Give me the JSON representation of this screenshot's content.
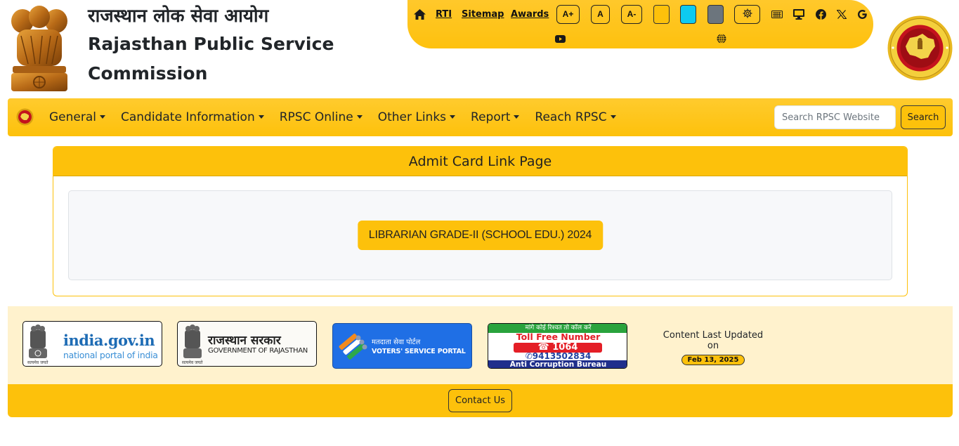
{
  "header": {
    "title_hindi": "राजस्थान लोक सेवा आयोग",
    "title_english_line1": "Rajasthan Public Service",
    "title_english_line2": "Commission",
    "emblem_icon": "ashoka-emblem",
    "seal_icon": "rpsc-seal"
  },
  "utility_bar": {
    "home_icon": "home-icon",
    "links": [
      "RTI",
      "Sitemap",
      "Awards"
    ],
    "font_size_buttons": [
      "A+",
      "A",
      "A-"
    ],
    "theme_swatches": [
      {
        "name": "yellow",
        "color": "#fdc10b"
      },
      {
        "name": "cyan",
        "color": "#0dcaf0"
      },
      {
        "name": "gray",
        "color": "#6c757d"
      }
    ],
    "settings_icon": "gear-icon",
    "icons": [
      "keyboard-icon",
      "monitor-icon",
      "facebook-icon",
      "x-twitter-icon",
      "google-icon",
      "youtube-icon",
      "globe-icon"
    ]
  },
  "navbar": {
    "logo_icon": "rpsc-seal-small",
    "items": [
      {
        "label": "General"
      },
      {
        "label": "Candidate Information"
      },
      {
        "label": "RPSC Online"
      },
      {
        "label": "Other Links"
      },
      {
        "label": "Report"
      },
      {
        "label": "Reach RPSC"
      }
    ],
    "search_placeholder": "Search RPSC Website",
    "search_value": "",
    "search_button": "Search"
  },
  "main": {
    "card_title": "Admit Card Link Page",
    "admit_card_link": "LIBRARIAN GRADE-II (SCHOOL EDU.) 2024"
  },
  "footer": {
    "logos": [
      {
        "title": "india.gov.in",
        "subtitle": "national portal of india",
        "motto": "सत्यमेव जयते"
      },
      {
        "title": "राजस्थान सरकार",
        "subtitle": "GOVERNMENT OF RAJASTHAN",
        "motto": "सत्यमेव जयते"
      },
      {
        "title": "मतदाता सेवा पोर्टल",
        "subtitle": "VOTERS' SERVICE PORTAL"
      },
      {
        "top": "मांगे कोई रिश्वत तो कॉल करें",
        "line1": "Toll Free Number",
        "number": "1064",
        "whatsapp": "9413502834",
        "bottom": "Anti Corruption Bureau"
      }
    ],
    "updated_label": "Content Last Updated on",
    "updated_date": "Feb 13, 2025",
    "contact_button": "Contact Us"
  },
  "colors": {
    "brand_yellow": "#fdc10b",
    "logo_band_bg": "#fff2cd",
    "text_dark": "#212529"
  }
}
